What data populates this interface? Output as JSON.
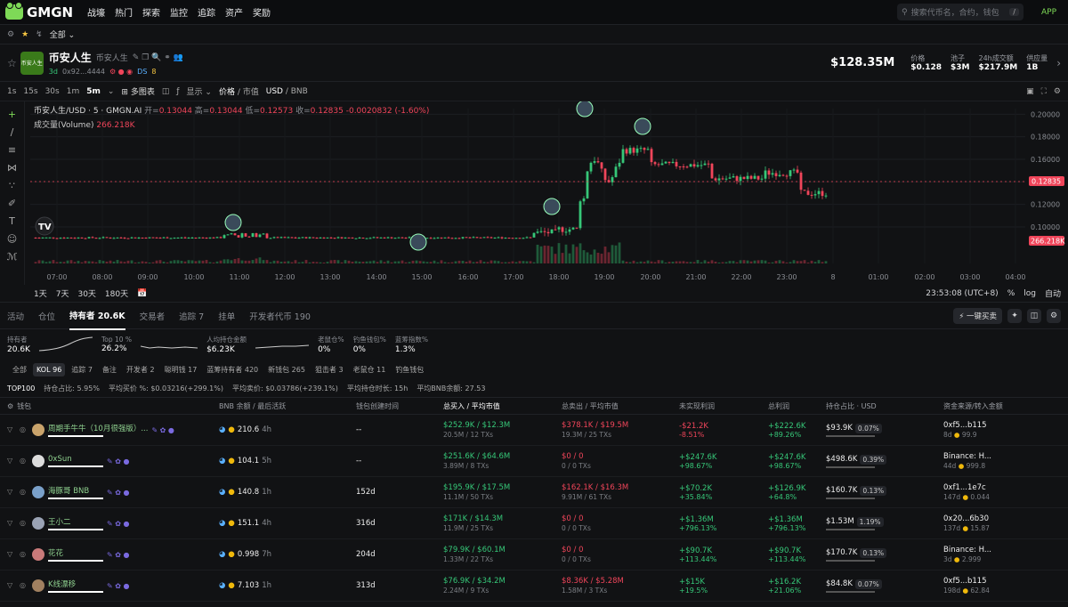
{
  "nav": {
    "logo": "GMGN",
    "items": [
      "战壕",
      "热门",
      "探索",
      "监控",
      "追踪",
      "资产",
      "奖励"
    ],
    "search_placeholder": "搜索代币名，合约，钱包",
    "search_kbd": "/",
    "app": "APP"
  },
  "bar2": {
    "filter": "全部"
  },
  "token": {
    "logo_text": "币安人生",
    "name": "币安人生",
    "subname": "币安人生",
    "age": "3d",
    "address": "0x92...4444",
    "badge": "DS",
    "holders_badge": "8",
    "market_cap": "$128.35M",
    "stats": [
      {
        "label": "价格",
        "value": "$0.128"
      },
      {
        "label": "池子",
        "value": "$3M"
      },
      {
        "label": "24h成交额",
        "value": "$217.9M"
      },
      {
        "label": "供应量",
        "value": "1B"
      }
    ]
  },
  "chart_toolbar": {
    "intervals": [
      "1s",
      "15s",
      "30s",
      "1m",
      "5m"
    ],
    "multi": "多图表",
    "display": "显示",
    "price": "价格",
    "mcap": "市值",
    "usd": "USD",
    "bnb": "BNB"
  },
  "chart_info": {
    "title": "币安人生/USD · 5 · GMGN.AI",
    "open_l": "开=",
    "open": "0.13044",
    "high_l": "高=",
    "high": "0.13044",
    "low_l": "低=",
    "low": "0.12573",
    "close_l": "收=",
    "close": "0.12835",
    "change": "-0.0020832 (-1.60%)",
    "volume_label": "成交量(Volume)",
    "volume": "266.218K",
    "last_price_tag": "0.12835",
    "last_vol_tag": "266.218K"
  },
  "chart_data": {
    "type": "candlestick",
    "yticks": [
      "0.20000",
      "0.18000",
      "0.16000",
      "0.14000",
      "0.12000",
      "0.10000"
    ],
    "xticks": [
      "07:00",
      "08:00",
      "09:00",
      "10:00",
      "11:00",
      "12:00",
      "13:00",
      "14:00",
      "15:00",
      "16:00",
      "17:00",
      "18:00",
      "19:00",
      "20:00",
      "21:00",
      "22:00",
      "23:00",
      "8",
      "01:00",
      "02:00",
      "03:00",
      "04:00"
    ],
    "ylim": [
      0.085,
      0.205
    ],
    "last": 0.12835
  },
  "range": {
    "items": [
      "1天",
      "7天",
      "30天",
      "180天"
    ],
    "clock": "23:53:08 (UTC+8)",
    "pct": "%",
    "log": "log",
    "auto": "自动"
  },
  "tabs": {
    "items": [
      "活动",
      "仓位",
      "持有者 20.6K",
      "交易者",
      "追踪 7",
      "挂单",
      "开发者代币 190"
    ],
    "quick_buy": "一键买卖"
  },
  "summary": [
    {
      "label": "持有者",
      "value": "20.6K"
    },
    {
      "label": "Top 10 %",
      "value": "26.2%"
    },
    {
      "label": "人均持仓金额",
      "value": "$6.23K"
    },
    {
      "label": "老鼠仓%",
      "value": "0%"
    },
    {
      "label": "钓鱼钱包%",
      "value": "0%"
    },
    {
      "label": "蓝筹指数%",
      "value": "1.3%"
    }
  ],
  "filters": [
    "全部",
    "KOL 96",
    "追踪 7",
    "备注",
    "开发者 2",
    "聪明钱 17",
    "蓝筹持有者 420",
    "新钱包 265",
    "狙击者 3",
    "老鼠仓 11",
    "钓鱼钱包"
  ],
  "top100": {
    "label": "TOP100",
    "hold": "持仓占比: 5.95%",
    "buy": "平均买价 %: $0.03216(+299.1%)",
    "sell": "平均卖价: $0.03786(+239.1%)",
    "time": "平均持仓时长: 15h",
    "bnb": "平均BNB余额: 27.53"
  },
  "columns": [
    "钱包",
    "BNB 余额 / 最后活跃",
    "钱包创建时间",
    "总买入 / 平均市值",
    "总卖出 / 平均市值",
    "未实现利润",
    "总利润",
    "持仓占比 · USD",
    "资金来源/转入金额"
  ],
  "rows": [
    {
      "name": "周期手牛牛（10月很强版）...",
      "bnb": "210.6",
      "active": "4h",
      "created": "--",
      "buy": "$252.9K / $12.3M",
      "buy_sub": "20.5M / 12 TXs",
      "sell": "$378.1K / $19.5M",
      "sell_sub": "19.3M / 25 TXs",
      "unreal": "-$21.2K",
      "unreal_pct": "-8.51%",
      "profit": "+$222.6K",
      "profit_pct": "+89.26%",
      "usd": "$93.9K",
      "pct": "0.07%",
      "src": "0xf5...b115",
      "src_sub": "8d",
      "src_amt": "99.9"
    },
    {
      "name": "0xSun",
      "bnb": "104.1",
      "active": "5h",
      "created": "--",
      "buy": "$251.6K / $64.6M",
      "buy_sub": "3.89M / 8 TXs",
      "sell": "$0 / 0",
      "sell_sub": "0 / 0 TXs",
      "unreal": "+$247.6K",
      "unreal_pct": "+98.67%",
      "profit": "+$247.6K",
      "profit_pct": "+98.67%",
      "usd": "$498.6K",
      "pct": "0.39%",
      "src": "Binance: H...",
      "src_sub": "44d",
      "src_amt": "999.8"
    },
    {
      "name": "海豚哥 BNB",
      "bnb": "140.8",
      "active": "1h",
      "created": "152d",
      "buy": "$195.9K / $17.5M",
      "buy_sub": "11.1M / 50 TXs",
      "sell": "$162.1K / $16.3M",
      "sell_sub": "9.91M / 61 TXs",
      "unreal": "+$70.2K",
      "unreal_pct": "+35.84%",
      "profit": "+$126.9K",
      "profit_pct": "+64.8%",
      "usd": "$160.7K",
      "pct": "0.13%",
      "src": "0xf1...1e7c",
      "src_sub": "147d",
      "src_amt": "0.044"
    },
    {
      "name": "王小二",
      "bnb": "151.1",
      "active": "4h",
      "created": "316d",
      "buy": "$171K / $14.3M",
      "buy_sub": "11.9M / 25 TXs",
      "sell": "$0 / 0",
      "sell_sub": "0 / 0 TXs",
      "unreal": "+$1.36M",
      "unreal_pct": "+796.13%",
      "profit": "+$1.36M",
      "profit_pct": "+796.13%",
      "usd": "$1.53M",
      "pct": "1.19%",
      "src": "0x20...6b30",
      "src_sub": "137d",
      "src_amt": "15.87"
    },
    {
      "name": "花花",
      "bnb": "0.998",
      "active": "7h",
      "created": "204d",
      "buy": "$79.9K / $60.1M",
      "buy_sub": "1.33M / 22 TXs",
      "sell": "$0 / 0",
      "sell_sub": "0 / 0 TXs",
      "unreal": "+$90.7K",
      "unreal_pct": "+113.44%",
      "profit": "+$90.7K",
      "profit_pct": "+113.44%",
      "usd": "$170.7K",
      "pct": "0.13%",
      "src": "Binance: H...",
      "src_sub": "3d",
      "src_amt": "2.999"
    },
    {
      "name": "K线漂移",
      "bnb": "7.103",
      "active": "1h",
      "created": "313d",
      "buy": "$76.9K / $34.2M",
      "buy_sub": "2.24M / 9 TXs",
      "sell": "$8.36K / $5.28M",
      "sell_sub": "1.58M / 3 TXs",
      "unreal": "+$15K",
      "unreal_pct": "+19.5%",
      "profit": "+$16.2K",
      "profit_pct": "+21.06%",
      "usd": "$84.8K",
      "pct": "0.07%",
      "src": "0xf5...b115",
      "src_sub": "198d",
      "src_amt": "62.84"
    }
  ],
  "colors": {
    "up": "#36c778",
    "down": "#f0455a",
    "bg": "#111214"
  }
}
